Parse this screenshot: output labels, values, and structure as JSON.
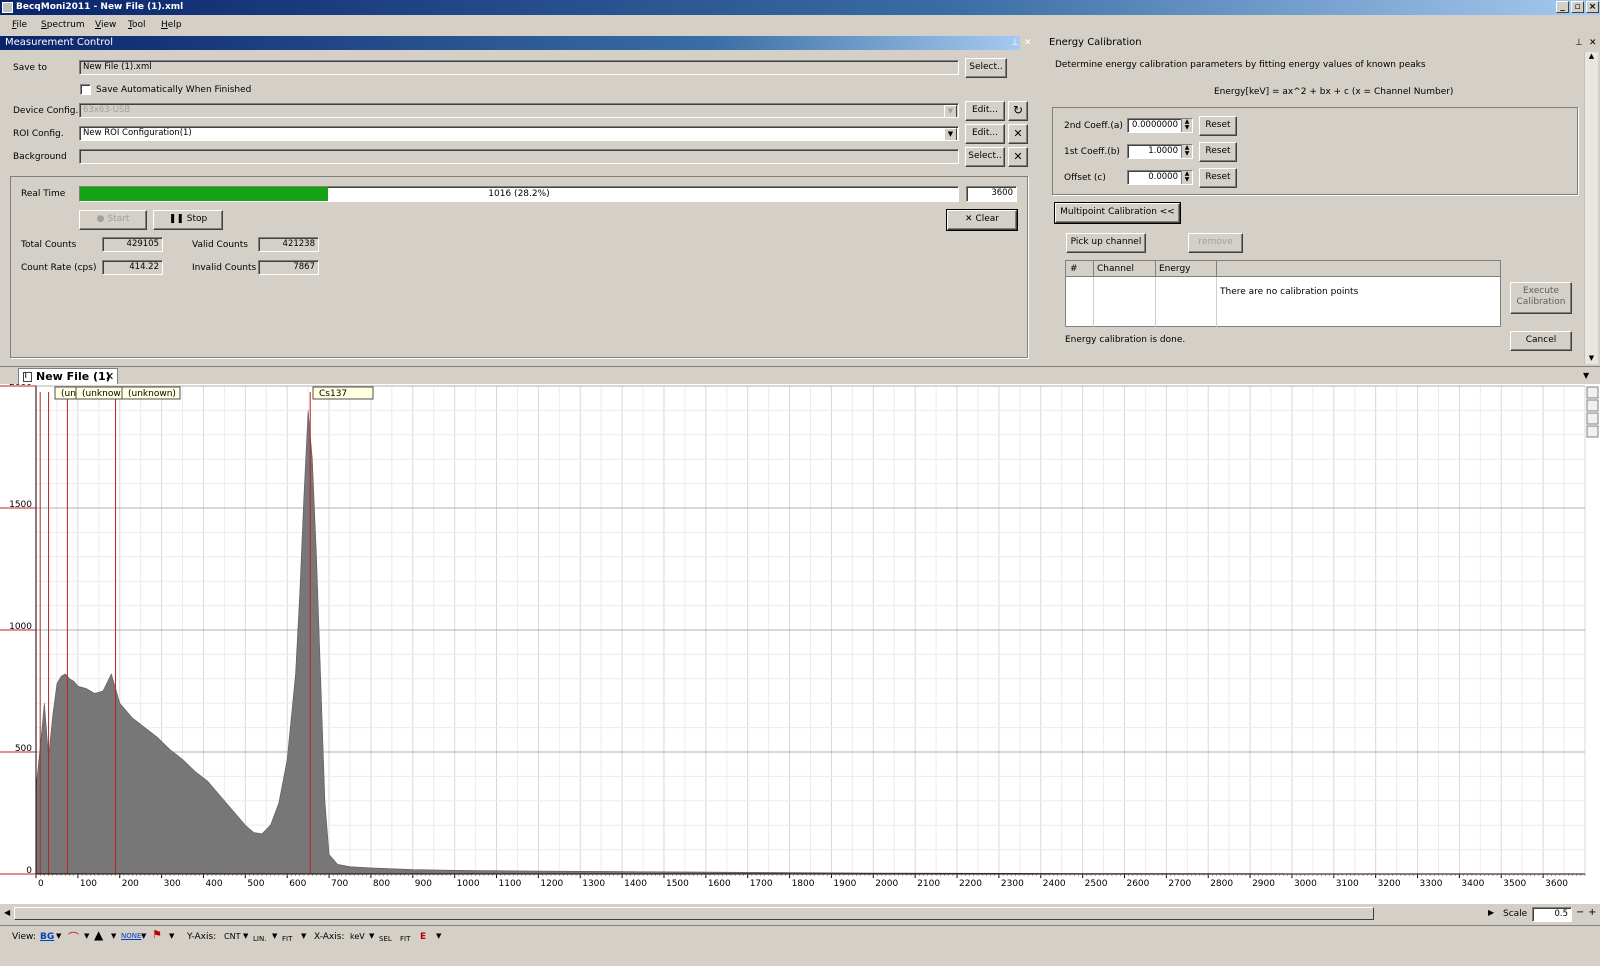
{
  "window": {
    "title": "BecqMoni2011 - New File (1).xml",
    "buttons": [
      "_",
      "▫",
      "×"
    ]
  },
  "menu": [
    "File",
    "Spectrum",
    "View",
    "Tool",
    "Help"
  ],
  "measurement": {
    "header": "Measurement Control",
    "save_to_label": "Save to",
    "save_to_value": "New File (1).xml",
    "select_label": "Select..",
    "auto_save_label": "Save Automatically When Finished",
    "device_label": "Device Config.",
    "device_value": "63x63-USB",
    "edit_label": "Edit...",
    "roi_label": "ROI Config.",
    "roi_value": "New ROI Configuration(1)",
    "background_label": "Background",
    "background_value": "",
    "real_time_label": "Real Time",
    "progress_text": "1016 (28.2%)",
    "progress_fraction": 0.282,
    "real_time_value": "3600",
    "start_label": "Start",
    "stop_label": "Stop",
    "clear_label": "Clear",
    "total_counts_label": "Total Counts",
    "total_counts_value": "429105",
    "valid_counts_label": "Valid Counts",
    "valid_counts_value": "421238",
    "count_rate_label": "Count Rate (cps)",
    "count_rate_value": "414.22",
    "invalid_counts_label": "Invalid Counts",
    "invalid_counts_value": "7867"
  },
  "calibration": {
    "header": "Energy Calibration",
    "description": "Determine energy calibration parameters by fitting energy values of known peaks",
    "formula": "Energy[keV] = ax^2 + bx + c  (x = Channel Number)",
    "coeff_a_label": "2nd Coeff.(a)",
    "coeff_a_value": "0.0000000",
    "coeff_b_label": "1st Coeff.(b)",
    "coeff_b_value": "1.0000",
    "coeff_c_label": "Offset (c)",
    "coeff_c_value": "0.0000",
    "reset_label": "Reset",
    "multipoint_label": "Multipoint Calibration <<",
    "pickup_label": "Pick up channel",
    "remove_label": "remove",
    "table_headers": [
      "#",
      "Channel",
      "Energy"
    ],
    "empty_message": "There are no calibration points",
    "execute_label_1": "Execute",
    "execute_label_2": "Calibration",
    "status": "Energy calibration is done.",
    "cancel_label": "Cancel"
  },
  "document": {
    "tab_label": "New File (1)",
    "roi_labels": [
      "(un",
      "(unknown",
      "(unknown)",
      "Cs137"
    ]
  },
  "chart_data": {
    "type": "area",
    "xlabel": "",
    "ylabel": "",
    "xlim": [
      0,
      3700
    ],
    "ylim": [
      0,
      2000
    ],
    "x_ticks": [
      0,
      100,
      200,
      300,
      400,
      500,
      600,
      700,
      800,
      900,
      1000,
      1100,
      1200,
      1300,
      1400,
      1500,
      1600,
      1700,
      1800,
      1900,
      2000,
      2100,
      2200,
      2300,
      2400,
      2500,
      2600,
      2700,
      2800,
      2900,
      3000,
      3100,
      3200,
      3300,
      3400,
      3500,
      3600
    ],
    "y_ticks": [
      0,
      500,
      1000,
      1500,
      2000
    ],
    "series": [
      {
        "x": [
          0,
          10,
          20,
          30,
          40,
          50,
          60,
          70,
          80,
          90,
          100,
          120,
          140,
          160,
          180,
          200,
          230,
          260,
          290,
          320,
          350,
          380,
          410,
          440,
          470,
          500,
          520,
          540,
          560,
          580,
          600,
          620,
          630,
          640,
          650,
          660,
          670,
          680,
          690,
          700,
          720,
          750,
          800,
          900,
          1000,
          1200,
          1400,
          1600,
          1800,
          2000,
          2500,
          3000,
          3700
        ],
        "y": [
          350,
          520,
          700,
          480,
          650,
          780,
          810,
          820,
          800,
          790,
          770,
          760,
          740,
          750,
          820,
          700,
          640,
          600,
          560,
          510,
          470,
          420,
          380,
          320,
          260,
          200,
          170,
          165,
          200,
          290,
          470,
          820,
          1150,
          1550,
          1900,
          1700,
          1300,
          800,
          300,
          80,
          40,
          30,
          25,
          18,
          15,
          12,
          10,
          8,
          6,
          4,
          2,
          1,
          0
        ]
      }
    ],
    "roi_markers_x": [
      10,
      30,
      75,
      190,
      655
    ],
    "grid": true,
    "legend": "none"
  },
  "scrollbar": {
    "scale_label": "Scale",
    "scale_value": "0.5"
  },
  "toolbar": {
    "view_label": "View:",
    "bg_label": "BG",
    "none_label": "NONE",
    "yaxis_label": "Y-Axis:",
    "cnt_label": "CNT",
    "lin_label": "LIN.",
    "fit_label": "FIT",
    "xaxis_label": "X-Axis:",
    "kev_label": "keV",
    "sel_label": "SEL",
    "e_label": "E"
  }
}
